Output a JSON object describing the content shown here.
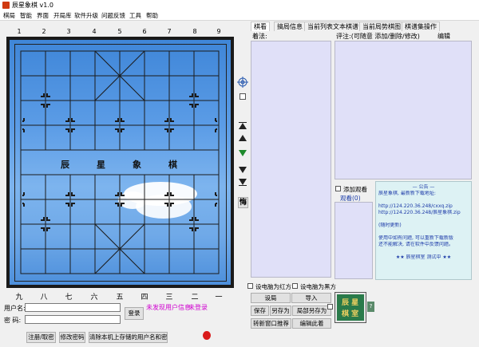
{
  "window": {
    "title": "辰星象棋 v1.0"
  },
  "menu": [
    "棋局",
    "智能",
    "界面",
    "开局库",
    "软件升级",
    "问题反馈",
    "工具",
    "帮助"
  ],
  "board": {
    "file_labels_top": [
      "1",
      "2",
      "3",
      "4",
      "5",
      "6",
      "7",
      "8",
      "9"
    ],
    "file_labels_bottom": [
      "九",
      "八",
      "七",
      "六",
      "五",
      "四",
      "三",
      "二",
      "一"
    ],
    "river_text": [
      "辰",
      "星",
      "象",
      "棋"
    ]
  },
  "login": {
    "username_label": "用户名:",
    "password_label": "密  码:",
    "login_button": "登录",
    "status_user": "未发现用户信息",
    "status_login": "未登录",
    "register_button": "注册/取密",
    "change_password_button": "修改密码",
    "clear_button": "清除本机上存储的用户名和密码"
  },
  "side_tools": {
    "regret_button": "悔"
  },
  "tabs": [
    "棋看",
    "搞局信息",
    "当前列表文本棋谱",
    "当前局势棋图",
    "棋谱集操作"
  ],
  "annotation": {
    "moves_label": "着法:",
    "comment_label": "评注:(可随意 添加/删除/修改)",
    "edit_label": "编辑",
    "add_watch_label": "添加观看",
    "watch_count_label": "观看(0)"
  },
  "announcement": {
    "title": "— 公告 —",
    "lines": [
      "辰星象棋, 最新新下载地址:",
      "",
      "http://124.220.36.248/cxxq.zip",
      "http://124.220.36.248/辰星象棋.zip",
      "",
      "(随时更新)",
      "",
      "使用中如有问题, 可以重新下载新版",
      "还不能解决, 请在软件中反馈问题。",
      "",
      "★★  辰星棋室  测试中  ★★"
    ]
  },
  "options": {
    "computer_red": "设电脑为红方",
    "computer_black": "设电脑为黑方"
  },
  "actions": {
    "set_board": "设局",
    "import": "导入",
    "save": "保存",
    "save_as": "另存为",
    "partial_save_as": "局部另存为",
    "new_window": "转新窗口推荐",
    "edit_record": "编辑此着"
  },
  "brand": {
    "text": "辰 星 棋 室",
    "help": "?"
  },
  "colors": {
    "sky_top": "#3f86d8",
    "panel_bg": "#e0e0f8",
    "announce_bg": "#ddf2f4",
    "announce_text": "#1c3aa8",
    "status_magenta": "#d000d0",
    "brand_green": "#2a7a4a"
  }
}
